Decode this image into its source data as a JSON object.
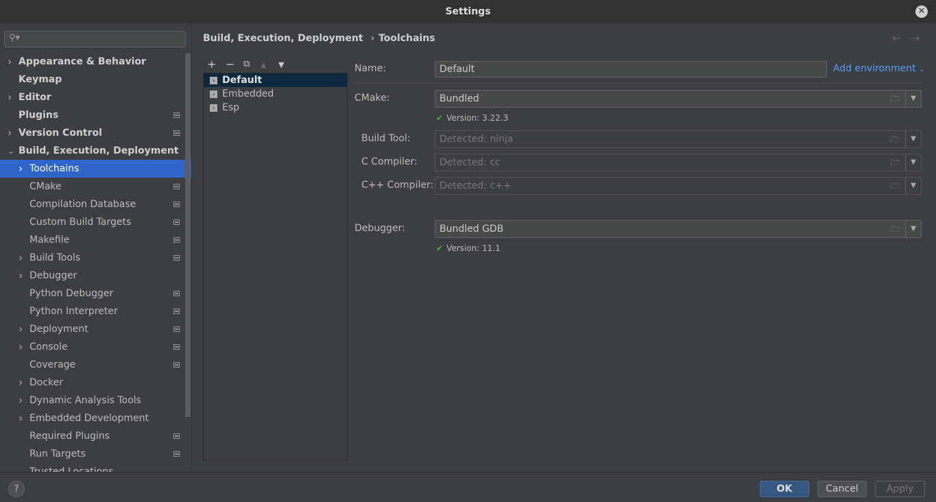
{
  "window": {
    "title": "Settings"
  },
  "search": {
    "placeholder": ""
  },
  "sidebar": {
    "items": [
      {
        "label": "Appearance & Behavior",
        "level": 0,
        "arrow": "right",
        "badge": false
      },
      {
        "label": "Keymap",
        "level": 0,
        "arrow": "",
        "badge": false
      },
      {
        "label": "Editor",
        "level": 0,
        "arrow": "right",
        "badge": false
      },
      {
        "label": "Plugins",
        "level": 0,
        "arrow": "",
        "badge": true
      },
      {
        "label": "Version Control",
        "level": 0,
        "arrow": "right",
        "badge": true
      },
      {
        "label": "Build, Execution, Deployment",
        "level": 0,
        "arrow": "down",
        "badge": false
      },
      {
        "label": "Toolchains",
        "level": 1,
        "arrow": "right",
        "badge": false,
        "selected": true
      },
      {
        "label": "CMake",
        "level": 1,
        "arrow": "",
        "badge": true
      },
      {
        "label": "Compilation Database",
        "level": 1,
        "arrow": "",
        "badge": true
      },
      {
        "label": "Custom Build Targets",
        "level": 1,
        "arrow": "",
        "badge": true
      },
      {
        "label": "Makefile",
        "level": 1,
        "arrow": "",
        "badge": true
      },
      {
        "label": "Build Tools",
        "level": 1,
        "arrow": "right",
        "badge": true
      },
      {
        "label": "Debugger",
        "level": 1,
        "arrow": "right",
        "badge": false
      },
      {
        "label": "Python Debugger",
        "level": 1,
        "arrow": "",
        "badge": true
      },
      {
        "label": "Python Interpreter",
        "level": 1,
        "arrow": "",
        "badge": true
      },
      {
        "label": "Deployment",
        "level": 1,
        "arrow": "right",
        "badge": true
      },
      {
        "label": "Console",
        "level": 1,
        "arrow": "right",
        "badge": true
      },
      {
        "label": "Coverage",
        "level": 1,
        "arrow": "",
        "badge": true
      },
      {
        "label": "Docker",
        "level": 1,
        "arrow": "right",
        "badge": false
      },
      {
        "label": "Dynamic Analysis Tools",
        "level": 1,
        "arrow": "right",
        "badge": false
      },
      {
        "label": "Embedded Development",
        "level": 1,
        "arrow": "right",
        "badge": false
      },
      {
        "label": "Required Plugins",
        "level": 1,
        "arrow": "",
        "badge": true
      },
      {
        "label": "Run Targets",
        "level": 1,
        "arrow": "",
        "badge": true
      },
      {
        "label": "Trusted Locations",
        "level": 1,
        "arrow": "",
        "badge": false
      }
    ]
  },
  "breadcrumb": {
    "parent": "Build, Execution, Deployment",
    "sep": "›",
    "current": "Toolchains"
  },
  "toolchains": {
    "items": [
      {
        "label": "Default",
        "selected": true
      },
      {
        "label": "Embedded"
      },
      {
        "label": "Esp"
      }
    ]
  },
  "form": {
    "name_label": "Name:",
    "name_value": "Default",
    "add_env": "Add environment",
    "fields": [
      {
        "label": "CMake:",
        "value": "Bundled",
        "disabled": false
      },
      {
        "label": "Build Tool:",
        "value": "Detected: ninja",
        "disabled": true
      },
      {
        "label": "C Compiler:",
        "value": "Detected: cc",
        "disabled": true
      },
      {
        "label": "C++ Compiler:",
        "value": "Detected: c++",
        "disabled": true
      },
      {
        "label": "Debugger:",
        "value": "Bundled GDB",
        "disabled": false
      }
    ],
    "cmake_version": "Version: 3.22.3",
    "debugger_version": "Version: 11.1"
  },
  "footer": {
    "ok": "OK",
    "cancel": "Cancel",
    "apply": "Apply",
    "help": "?"
  },
  "colors": {
    "accent": "#2f65ca",
    "ok_button": "#365880",
    "link": "#589df6",
    "check": "#4caf50"
  }
}
